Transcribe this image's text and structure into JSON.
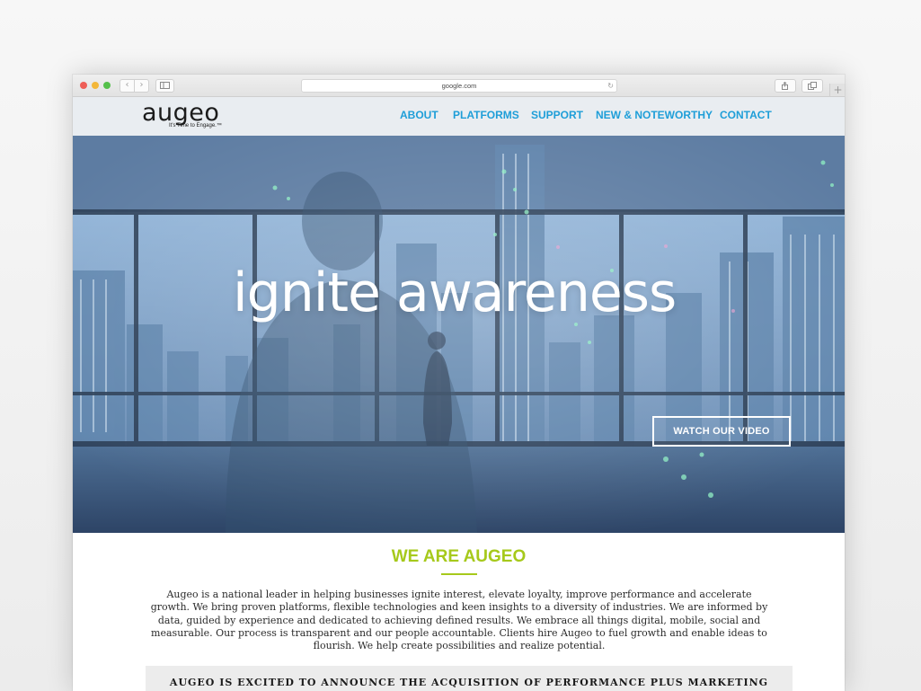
{
  "browser": {
    "url": "google.com",
    "back_icon": "‹",
    "forward_icon": "›",
    "reload_icon": "↻",
    "new_tab_icon": "+"
  },
  "header": {
    "logo_text": "augeo",
    "tagline": "It's Time to Engage.™",
    "nav": [
      {
        "label": "ABOUT"
      },
      {
        "label": "PLATFORMS"
      },
      {
        "label": "SUPPORT"
      },
      {
        "label": "NEW & NOTEWORTHY"
      },
      {
        "label": "CONTACT"
      }
    ],
    "nav_color": "#1e9ed8"
  },
  "hero": {
    "headline": "ignite awareness",
    "cta_label": "WATCH OUR VIDEO"
  },
  "about": {
    "title": "WE ARE AUGEO",
    "accent_color": "#a6c91b",
    "body": "Augeo is a national leader in helping businesses ignite interest, elevate loyalty, improve performance and accelerate growth. We bring proven platforms, flexible technologies and keen insights to a diversity of industries. We are informed by data, guided by experience and dedicated to achieving defined results. We embrace all things digital, mobile, social and measurable. Our process is transparent and our people accountable. Clients hire Augeo to fuel growth and enable ideas to flourish. We help create possibilities and realize potential."
  },
  "announcement": {
    "text": "AUGEO IS EXCITED TO ANNOUNCE THE ACQUISITION OF PERFORMANCE PLUS MARKETING"
  }
}
